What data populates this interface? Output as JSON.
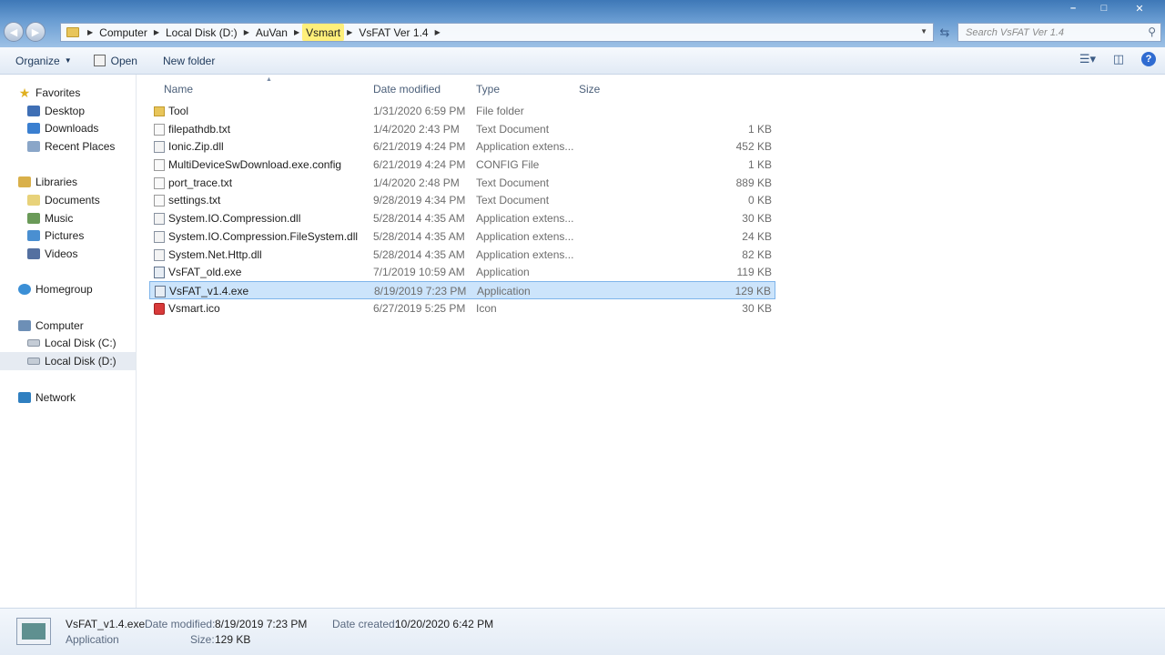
{
  "window": {
    "controls": [
      "minimize",
      "maximize",
      "close"
    ]
  },
  "nav": {
    "back_icon": "back-arrow-icon",
    "forward_icon": "forward-arrow-icon"
  },
  "breadcrumb": [
    "Computer",
    "Local Disk (D:)",
    "AuVan",
    "Vsmart",
    "VsFAT Ver 1.4"
  ],
  "search": {
    "placeholder": "Search VsFAT Ver 1.4"
  },
  "toolbar": {
    "organize": "Organize",
    "open": "Open",
    "new_folder": "New folder"
  },
  "sidebar": {
    "favorites": "Favorites",
    "desktop": "Desktop",
    "downloads": "Downloads",
    "recent": "Recent Places",
    "libraries": "Libraries",
    "documents": "Documents",
    "music": "Music",
    "pictures": "Pictures",
    "videos": "Videos",
    "homegroup": "Homegroup",
    "computer": "Computer",
    "disk_c": "Local Disk (C:)",
    "disk_d": "Local Disk (D:)",
    "network": "Network"
  },
  "columns": {
    "name": "Name",
    "date": "Date modified",
    "type": "Type",
    "size": "Size"
  },
  "files": [
    {
      "name": "Tool",
      "date": "1/31/2020 6:59 PM",
      "type": "File folder",
      "size": ""
    },
    {
      "name": "filepathdb.txt",
      "date": "1/4/2020 2:43 PM",
      "type": "Text Document",
      "size": "1 KB"
    },
    {
      "name": "Ionic.Zip.dll",
      "date": "6/21/2019 4:24 PM",
      "type": "Application extens...",
      "size": "452 KB"
    },
    {
      "name": "MultiDeviceSwDownload.exe.config",
      "date": "6/21/2019 4:24 PM",
      "type": "CONFIG File",
      "size": "1 KB"
    },
    {
      "name": "port_trace.txt",
      "date": "1/4/2020 2:48 PM",
      "type": "Text Document",
      "size": "889 KB"
    },
    {
      "name": "settings.txt",
      "date": "9/28/2019 4:34 PM",
      "type": "Text Document",
      "size": "0 KB"
    },
    {
      "name": "System.IO.Compression.dll",
      "date": "5/28/2014 4:35 AM",
      "type": "Application extens...",
      "size": "30 KB"
    },
    {
      "name": "System.IO.Compression.FileSystem.dll",
      "date": "5/28/2014 4:35 AM",
      "type": "Application extens...",
      "size": "24 KB"
    },
    {
      "name": "System.Net.Http.dll",
      "date": "5/28/2014 4:35 AM",
      "type": "Application extens...",
      "size": "82 KB"
    },
    {
      "name": "VsFAT_old.exe",
      "date": "7/1/2019 10:59 AM",
      "type": "Application",
      "size": "119 KB"
    },
    {
      "name": "VsFAT_v1.4.exe",
      "date": "8/19/2019 7:23 PM",
      "type": "Application",
      "size": "129 KB"
    },
    {
      "name": "Vsmart.ico",
      "date": "6/27/2019 5:25 PM",
      "type": "Icon",
      "size": "30 KB"
    }
  ],
  "details": {
    "filename": "VsFAT_v1.4.exe",
    "kind": "Application",
    "modified_label": "Date modified:",
    "modified_value": "8/19/2019 7:23 PM",
    "size_label": "Size:",
    "size_value": "129 KB",
    "created_label": "Date created:",
    "created_value": "10/20/2020 6:42 PM"
  }
}
